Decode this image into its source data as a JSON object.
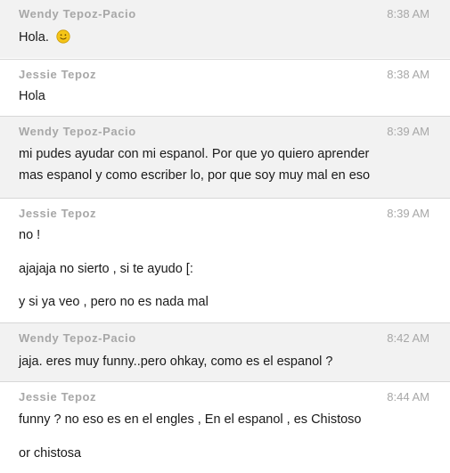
{
  "messages": [
    {
      "sender": "Wendy Tepoz-Pacio",
      "time": "8:38 AM",
      "lines": [
        "Hola."
      ],
      "emoji": "smiley-icon"
    },
    {
      "sender": "Jessie Tepoz",
      "time": "8:38 AM",
      "lines": [
        "Hola"
      ]
    },
    {
      "sender": "Wendy Tepoz-Pacio",
      "time": "8:39 AM",
      "lines": [
        "mi pudes ayudar con mi espanol. Por que yo quiero aprender",
        "mas espanol y como escriber lo, por que soy muy mal en eso"
      ]
    },
    {
      "sender": "Jessie Tepoz",
      "time": "8:39 AM",
      "lines": [
        "no !",
        "ajajaja no sierto , si te ayudo [:",
        "y si ya veo , pero no es nada mal"
      ]
    },
    {
      "sender": "Wendy Tepoz-Pacio",
      "time": "8:42 AM",
      "lines": [
        "jaja. eres muy funny..pero ohkay, como es el espanol ?"
      ]
    },
    {
      "sender": "Jessie Tepoz",
      "time": "8:44 AM",
      "lines": [
        "funny ? no eso es en el engles , En el espanol , es Chistoso",
        "or chistosa"
      ]
    }
  ],
  "colors": {
    "alt_background": "#f2f2f2",
    "sender_text": "#a7a7a7",
    "divider": "#d7d7d7",
    "smiley_face": "#f5c518"
  }
}
